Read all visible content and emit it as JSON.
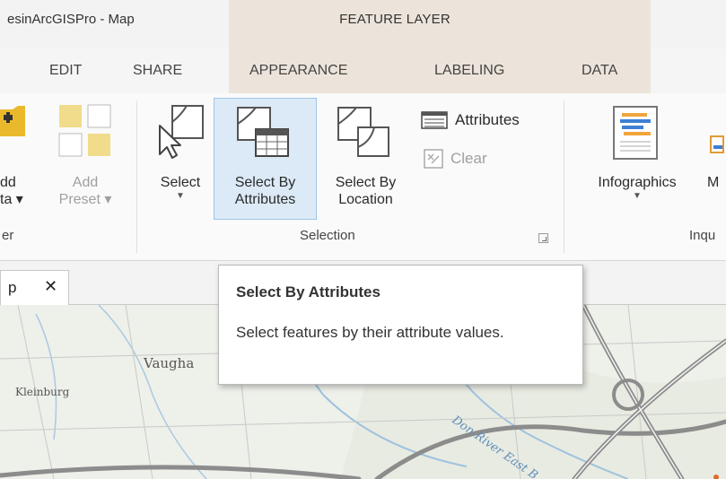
{
  "titlebar": {
    "title": "esinArcGISPro - Map",
    "context_title": "FEATURE LAYER"
  },
  "tabs": [
    {
      "label": "EDIT"
    },
    {
      "label": "SHARE"
    },
    {
      "label": "APPEARANCE"
    },
    {
      "label": "LABELING"
    },
    {
      "label": "DATA"
    }
  ],
  "ribbon": {
    "add_data": {
      "line1": "dd",
      "line2": "ta ▾"
    },
    "add_preset": {
      "line1": "Add",
      "line2": "Preset ▾"
    },
    "layer_group_label": "er",
    "select": {
      "label": "Select"
    },
    "select_by_attributes": {
      "line1": "Select By",
      "line2": "Attributes"
    },
    "select_by_location": {
      "line1": "Select By",
      "line2": "Location"
    },
    "attributes": {
      "label": "Attributes"
    },
    "clear": {
      "label": "Clear"
    },
    "selection_group_label": "Selection",
    "infographics": {
      "label": "Infographics"
    },
    "next_button_label": "M",
    "inquiry_group_label": "Inqu"
  },
  "map_tab": {
    "label": "p",
    "close": "✕"
  },
  "map": {
    "places": [
      "Vaugha",
      "Kleinburg"
    ],
    "river_label": "Don River East B"
  },
  "tooltip": {
    "title": "Select By Attributes",
    "body": "Select features by their attribute values."
  },
  "colors": {
    "context_band": "#ece4da",
    "active_button_bg": "#dceaf7",
    "active_button_border": "#9ec5e8",
    "preset_yellow": "#f1dc8c",
    "add_data_yellow": "#e9b92b",
    "infographics_orange": "#f0a53c",
    "infographics_blue": "#3c7fd4"
  }
}
